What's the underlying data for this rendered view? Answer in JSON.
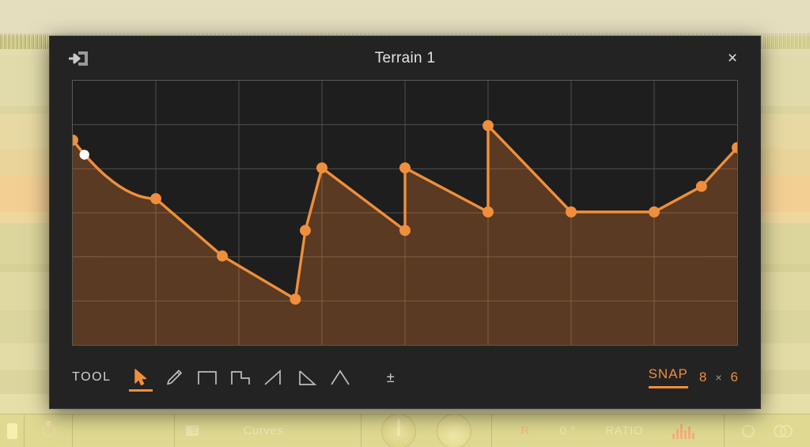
{
  "dialog": {
    "title": "Terrain 1",
    "import_icon": "import-arrow-icon",
    "close_label": "×"
  },
  "toolbar": {
    "label": "TOOL",
    "tools": [
      {
        "name": "pointer-tool",
        "icon": "cursor-arrow-icon",
        "active": true
      },
      {
        "name": "pencil-tool",
        "icon": "pencil-icon",
        "active": false
      },
      {
        "name": "square-wave-tool",
        "icon": "square-wave-icon",
        "active": false
      },
      {
        "name": "step-wave-tool",
        "icon": "step-wave-icon",
        "active": false
      },
      {
        "name": "ramp-up-tool",
        "icon": "ramp-up-icon",
        "active": false
      },
      {
        "name": "ramp-down-tool",
        "icon": "ramp-down-icon",
        "active": false
      },
      {
        "name": "triangle-wave-tool",
        "icon": "triangle-wave-icon",
        "active": false
      }
    ],
    "plusminus_label": "±",
    "snap_label": "SNAP",
    "snap_cols": "8",
    "snap_sep": "×",
    "snap_rows": "6"
  },
  "colors": {
    "accent": "#ef8f3c",
    "curve_fill": "#5a3a22",
    "graph_bg": "#1e1e1e",
    "grid_line": "#4e4e4e",
    "dialog_bg": "#232323",
    "handle_white": "#ffffff",
    "host_bg": "#ddd9a0"
  },
  "chart_data": {
    "type": "line",
    "title": "Terrain 1",
    "xlabel": "",
    "ylabel": "",
    "xlim": [
      0,
      8
    ],
    "ylim": [
      0,
      6
    ],
    "grid": true,
    "grid_cols": 8,
    "grid_rows": 6,
    "legend": "none",
    "notes": "Terrain envelope editor curve; values in grid units (x: 0-8 columns, y: 0-6 rows, y measured from bottom).",
    "points": [
      {
        "x": 0.0,
        "y": 4.65,
        "seg": "curve"
      },
      {
        "x": 1.0,
        "y": 3.32,
        "seg": "line"
      },
      {
        "x": 1.8,
        "y": 2.02,
        "seg": "line"
      },
      {
        "x": 2.68,
        "y": 1.04,
        "seg": "jump"
      },
      {
        "x": 2.8,
        "y": 2.6,
        "seg": "line"
      },
      {
        "x": 3.0,
        "y": 4.02,
        "seg": "line"
      },
      {
        "x": 4.0,
        "y": 2.6,
        "seg": "jump"
      },
      {
        "x": 4.0,
        "y": 4.02,
        "seg": "line"
      },
      {
        "x": 5.0,
        "y": 3.02,
        "seg": "jump"
      },
      {
        "x": 5.0,
        "y": 4.98,
        "seg": "line"
      },
      {
        "x": 6.0,
        "y": 3.02,
        "seg": "line"
      },
      {
        "x": 7.0,
        "y": 3.02,
        "seg": "line"
      },
      {
        "x": 7.57,
        "y": 3.6,
        "seg": "line"
      },
      {
        "x": 8.0,
        "y": 4.48,
        "seg": "end"
      }
    ],
    "tension_handle": {
      "x": 0.14,
      "y": 4.32,
      "color": "#ffffff"
    }
  },
  "host": {
    "strip_items": [
      {
        "name": "led-indicator",
        "label": ""
      },
      {
        "name": "power-button",
        "label": ""
      },
      {
        "name": "preset-browser",
        "label": ""
      },
      {
        "name": "preset-name",
        "label": "Curves"
      },
      {
        "name": "drive-knob",
        "label": ""
      },
      {
        "name": "tone-knob",
        "label": ""
      },
      {
        "name": "channel-r",
        "label": "R"
      },
      {
        "name": "phase-value",
        "label": "0 °"
      },
      {
        "name": "ratio-label",
        "label": "RATIO"
      },
      {
        "name": "meter-icon",
        "label": ""
      },
      {
        "name": "mono-icon",
        "label": ""
      },
      {
        "name": "stereo-icon",
        "label": ""
      }
    ]
  }
}
